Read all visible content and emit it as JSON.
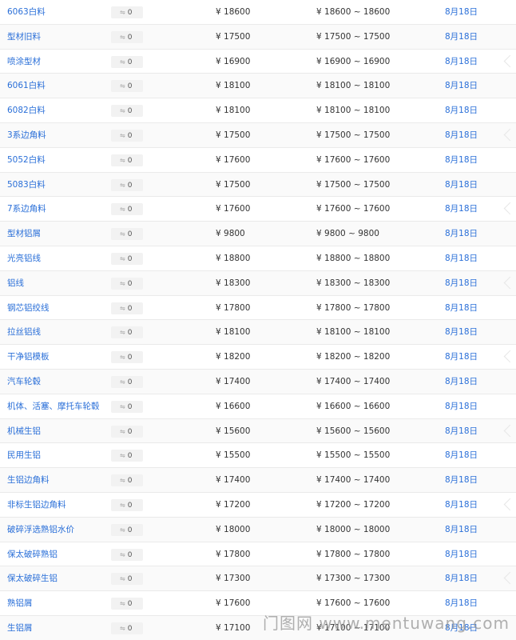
{
  "rows": [
    {
      "name": "6063白料",
      "change": "0",
      "price": "¥ 18600",
      "range": "¥ 18600 ~ 18600",
      "date": "8月18日"
    },
    {
      "name": "型材旧料",
      "change": "0",
      "price": "¥ 17500",
      "range": "¥ 17500 ~ 17500",
      "date": "8月18日"
    },
    {
      "name": "喷涂型材",
      "change": "0",
      "price": "¥ 16900",
      "range": "¥ 16900 ~ 16900",
      "date": "8月18日"
    },
    {
      "name": "6061白料",
      "change": "0",
      "price": "¥ 18100",
      "range": "¥ 18100 ~ 18100",
      "date": "8月18日"
    },
    {
      "name": "6082白料",
      "change": "0",
      "price": "¥ 18100",
      "range": "¥ 18100 ~ 18100",
      "date": "8月18日"
    },
    {
      "name": "3系边角料",
      "change": "0",
      "price": "¥ 17500",
      "range": "¥ 17500 ~ 17500",
      "date": "8月18日"
    },
    {
      "name": "5052白料",
      "change": "0",
      "price": "¥ 17600",
      "range": "¥ 17600 ~ 17600",
      "date": "8月18日"
    },
    {
      "name": "5083白料",
      "change": "0",
      "price": "¥ 17500",
      "range": "¥ 17500 ~ 17500",
      "date": "8月18日"
    },
    {
      "name": "7系边角料",
      "change": "0",
      "price": "¥ 17600",
      "range": "¥ 17600 ~ 17600",
      "date": "8月18日"
    },
    {
      "name": "型材铝屑",
      "change": "0",
      "price": "¥ 9800",
      "range": "¥ 9800 ~ 9800",
      "date": "8月18日"
    },
    {
      "name": "光亮铝线",
      "change": "0",
      "price": "¥ 18800",
      "range": "¥ 18800 ~ 18800",
      "date": "8月18日"
    },
    {
      "name": "铝线",
      "change": "0",
      "price": "¥ 18300",
      "range": "¥ 18300 ~ 18300",
      "date": "8月18日"
    },
    {
      "name": "钢芯铝绞线",
      "change": "0",
      "price": "¥ 17800",
      "range": "¥ 17800 ~ 17800",
      "date": "8月18日"
    },
    {
      "name": "拉丝铝线",
      "change": "0",
      "price": "¥ 18100",
      "range": "¥ 18100 ~ 18100",
      "date": "8月18日"
    },
    {
      "name": "干净铝模板",
      "change": "0",
      "price": "¥ 18200",
      "range": "¥ 18200 ~ 18200",
      "date": "8月18日"
    },
    {
      "name": "汽车轮毂",
      "change": "0",
      "price": "¥ 17400",
      "range": "¥ 17400 ~ 17400",
      "date": "8月18日"
    },
    {
      "name": "机体、活塞、摩托车轮毂",
      "change": "0",
      "price": "¥ 16600",
      "range": "¥ 16600 ~ 16600",
      "date": "8月18日"
    },
    {
      "name": "机械生铝",
      "change": "0",
      "price": "¥ 15600",
      "range": "¥ 15600 ~ 15600",
      "date": "8月18日"
    },
    {
      "name": "民用生铝",
      "change": "0",
      "price": "¥ 15500",
      "range": "¥ 15500 ~ 15500",
      "date": "8月18日"
    },
    {
      "name": "生铝边角料",
      "change": "0",
      "price": "¥ 17400",
      "range": "¥ 17400 ~ 17400",
      "date": "8月18日"
    },
    {
      "name": "非标生铝边角料",
      "change": "0",
      "price": "¥ 17200",
      "range": "¥ 17200 ~ 17200",
      "date": "8月18日"
    },
    {
      "name": "破碎浮选熟铝水价",
      "change": "0",
      "price": "¥ 18000",
      "range": "¥ 18000 ~ 18000",
      "date": "8月18日"
    },
    {
      "name": "保太破碎熟铝",
      "change": "0",
      "price": "¥ 17800",
      "range": "¥ 17800 ~ 17800",
      "date": "8月18日"
    },
    {
      "name": "保太破碎生铝",
      "change": "0",
      "price": "¥ 17300",
      "range": "¥ 17300 ~ 17300",
      "date": "8月18日"
    },
    {
      "name": "熟铝屑",
      "change": "0",
      "price": "¥ 17600",
      "range": "¥ 17600 ~ 17600",
      "date": "8月18日"
    },
    {
      "name": "生铝屑",
      "change": "0",
      "price": "¥ 17100",
      "range": "¥ 17100 ~ 17100",
      "date": "8月18日"
    }
  ],
  "watermark": "门图网 www.mentuwang.com",
  "colors": {
    "link": "#2a6fd8",
    "text": "#333333",
    "border": "#eaeaea"
  },
  "icons": {
    "change": "flat-arrow-icon",
    "edge": "chevron-left-icon"
  }
}
